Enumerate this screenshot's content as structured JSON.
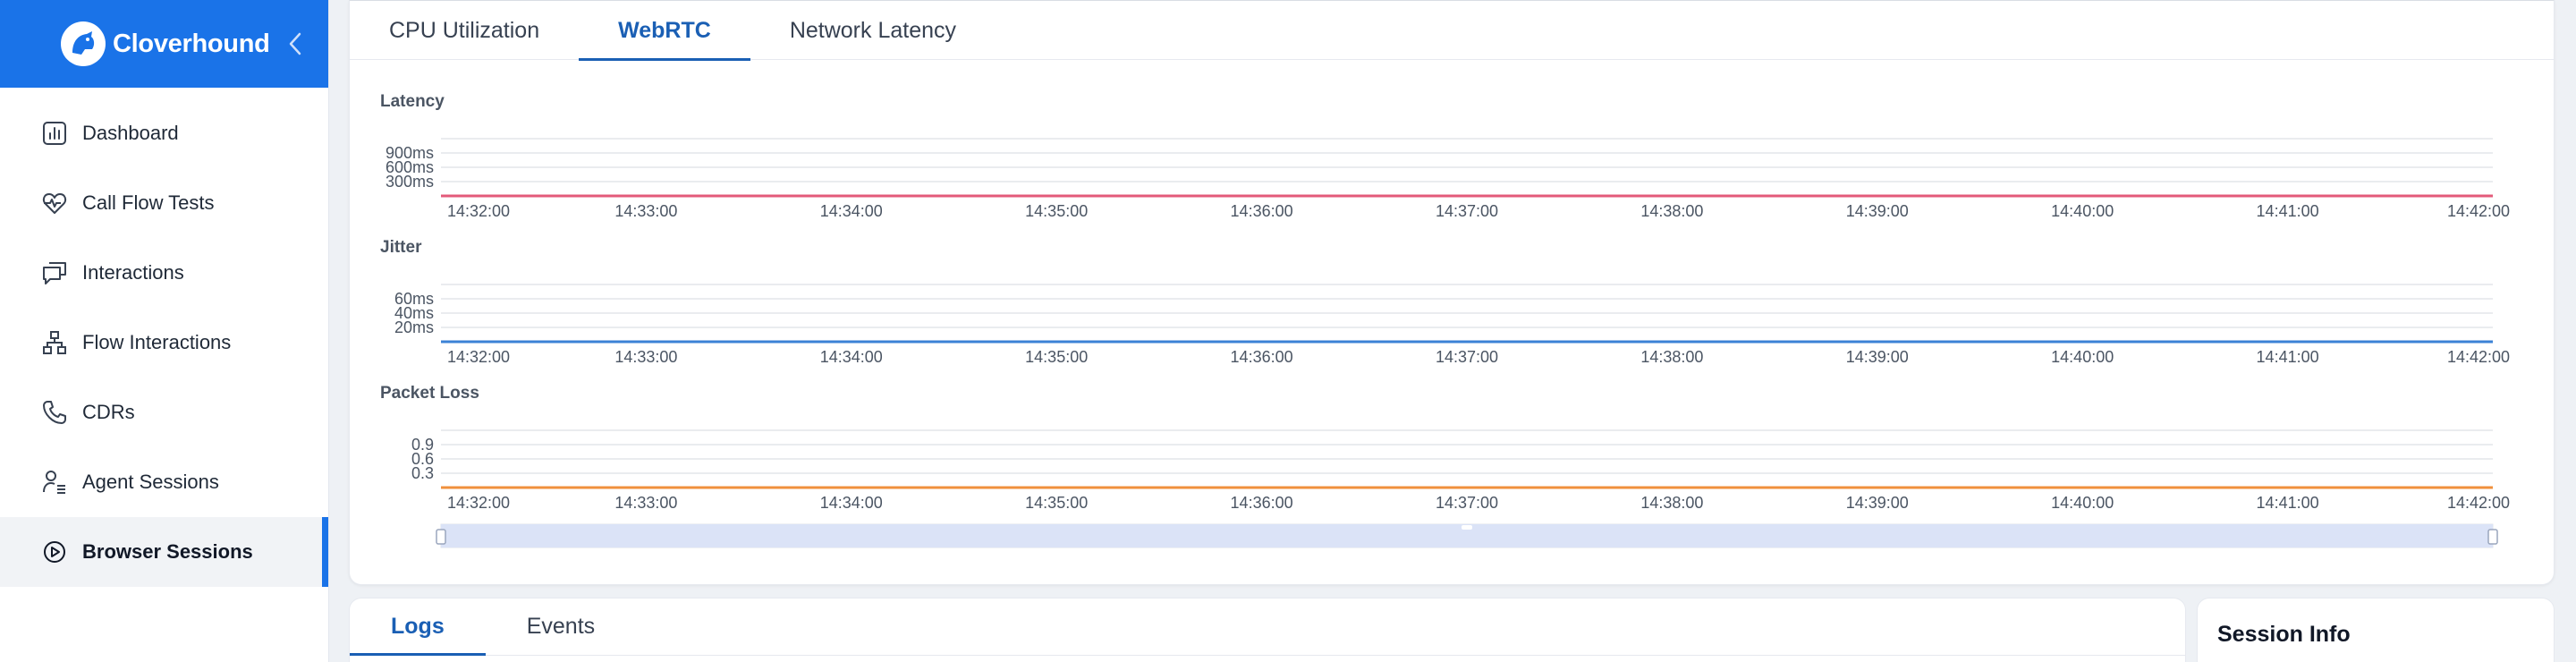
{
  "app": {
    "title": "Cloverhound"
  },
  "sidebar": {
    "items": [
      {
        "label": "Dashboard",
        "icon": "dashboard-icon"
      },
      {
        "label": "Call Flow Tests",
        "icon": "heart-pulse-icon"
      },
      {
        "label": "Interactions",
        "icon": "chat-bubbles-icon"
      },
      {
        "label": "Flow Interactions",
        "icon": "flow-hierarchy-icon"
      },
      {
        "label": "CDRs",
        "icon": "phone-icon"
      },
      {
        "label": "Agent Sessions",
        "icon": "agent-list-icon"
      },
      {
        "label": "Browser Sessions",
        "icon": "play-circle-icon",
        "active": true
      }
    ]
  },
  "tabs": [
    {
      "label": "CPU Utilization"
    },
    {
      "label": "WebRTC",
      "active": true
    },
    {
      "label": "Network Latency"
    }
  ],
  "colors": {
    "accent": "#1a73e8",
    "latency": "#e35a7a",
    "jitter": "#3b82d6",
    "packet_loss": "#f0903c"
  },
  "chart_data": [
    {
      "type": "line",
      "title": "Latency",
      "x": [
        "14:32:00",
        "14:33:00",
        "14:34:00",
        "14:35:00",
        "14:36:00",
        "14:37:00",
        "14:38:00",
        "14:39:00",
        "14:40:00",
        "14:41:00",
        "14:42:00"
      ],
      "yticks": [
        "300ms",
        "600ms",
        "900ms"
      ],
      "ylim": [
        0,
        1200
      ],
      "series": [
        {
          "values": [
            0,
            0,
            0,
            0,
            0,
            0,
            0,
            0,
            0,
            0,
            0
          ]
        }
      ]
    },
    {
      "type": "line",
      "title": "Jitter",
      "x": [
        "14:32:00",
        "14:33:00",
        "14:34:00",
        "14:35:00",
        "14:36:00",
        "14:37:00",
        "14:38:00",
        "14:39:00",
        "14:40:00",
        "14:41:00",
        "14:42:00"
      ],
      "yticks": [
        "20ms",
        "40ms",
        "60ms"
      ],
      "ylim": [
        0,
        80
      ],
      "series": [
        {
          "values": [
            0,
            0,
            0,
            0,
            0,
            0,
            0,
            0,
            0,
            0,
            0
          ]
        }
      ]
    },
    {
      "type": "line",
      "title": "Packet Loss",
      "x": [
        "14:32:00",
        "14:33:00",
        "14:34:00",
        "14:35:00",
        "14:36:00",
        "14:37:00",
        "14:38:00",
        "14:39:00",
        "14:40:00",
        "14:41:00",
        "14:42:00"
      ],
      "yticks": [
        "0.3",
        "0.6",
        "0.9"
      ],
      "ylim": [
        0,
        1.2
      ],
      "series": [
        {
          "values": [
            0,
            0,
            0,
            0,
            0,
            0,
            0,
            0,
            0,
            0,
            0
          ]
        }
      ]
    }
  ],
  "zoom": {
    "start": 0,
    "end": 1
  },
  "logs_tabs": [
    {
      "label": "Logs",
      "active": true
    },
    {
      "label": "Events"
    }
  ],
  "session_info": {
    "title": "Session Info"
  }
}
